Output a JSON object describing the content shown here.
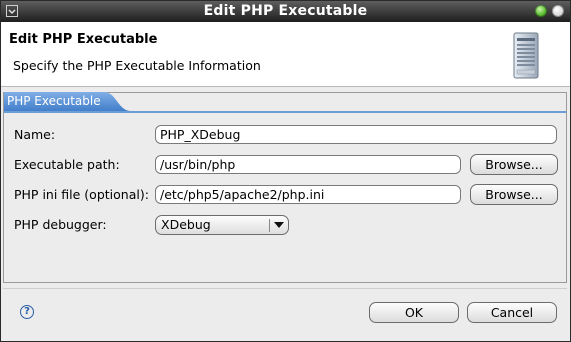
{
  "window": {
    "title": "Edit PHP Executable"
  },
  "header": {
    "title": "Edit PHP Executable",
    "subtitle": "Specify the PHP Executable Information",
    "icon": "server-icon"
  },
  "tab": {
    "label": "PHP Executable"
  },
  "form": {
    "name": {
      "label": "Name:",
      "value": "PHP_XDebug"
    },
    "exec_path": {
      "label": "Executable path:",
      "value": "/usr/bin/php",
      "browse": "Browse..."
    },
    "ini_file": {
      "label": "PHP ini file (optional):",
      "value": "/etc/php5/apache2/php.ini",
      "browse": "Browse..."
    },
    "debugger": {
      "label": "PHP debugger:",
      "value": "XDebug"
    }
  },
  "footer": {
    "ok": "OK",
    "cancel": "Cancel",
    "help_icon": "help-icon"
  },
  "colors": {
    "tab_active": "#4a86d0",
    "titlebar": "#2a2a2a"
  }
}
